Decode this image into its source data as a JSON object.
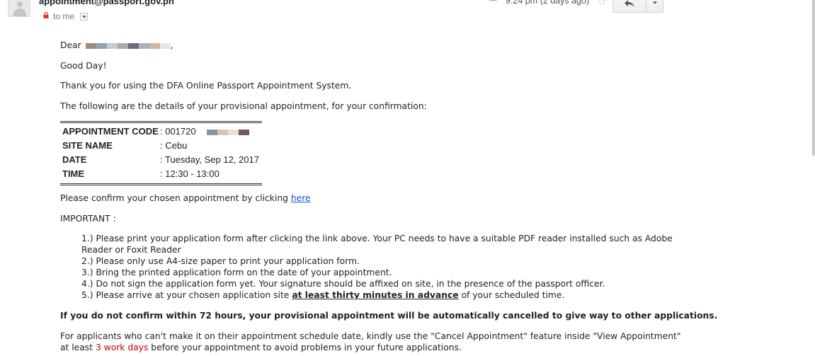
{
  "header": {
    "sender": "appointment@passport.gov.ph",
    "recipient_label": "to me",
    "time": "9:24 pm (2 days ago)"
  },
  "icons": [
    "avatar",
    "lock-icon",
    "chevron-down-icon",
    "paperclip-icon",
    "star-icon",
    "reply-icon",
    "more-options-icon"
  ],
  "redaction_colors": {
    "name": [
      "#9b8e7e",
      "#8fa3b0",
      "#c9c9cf",
      "#b1a6ad",
      "#6f6a78",
      "#a7b1c1",
      "#d4b49f",
      "#e2e6ec"
    ],
    "code": [
      "#8a92a6",
      "#d9c5b5",
      "#e8e0d8",
      "#6f5a55"
    ]
  },
  "email": {
    "greeting": "Dear",
    "greeting_punct": ",",
    "good_day": "Good Day!",
    "thank_you": "Thank you for using the DFA Online Passport Appointment System.",
    "intro": "The following are the details of your provisional appointment, for your confirmation:",
    "table": [
      {
        "label": "APPOINTMENT CODE",
        "value": ": 001720"
      },
      {
        "label": "SITE NAME",
        "value": ": Cebu"
      },
      {
        "label": "DATE",
        "value": ": Tuesday, Sep 12, 2017"
      },
      {
        "label": "TIME",
        "value": ": 12:30 - 13:00"
      }
    ],
    "confirm_prefix": "Please confirm your chosen appointment by clicking",
    "confirm_link": "here",
    "important_label": "IMPORTANT :",
    "items": {
      "item1_line1": "1.) Please print your application form after clicking the link above. Your PC needs to have a suitable PDF reader installed such as Adobe",
      "item1_line2": "Reader or Foxit Reader",
      "item2": "2.) Please only use A4-size paper to print your application form.",
      "item3": "3.) Bring the printed application form on the date of your appointment.",
      "item4": "4.) Do not sign the application form yet. Your signature should be affixed on site, in the presence of the passport officer.",
      "item5_prefix": "5.) Please arrive at your chosen application site",
      "item5_emphasis": "at least thirty minutes in advance",
      "item5_suffix": "of your scheduled time."
    },
    "warning": "If you do not confirm within 72 hours, your provisional appointment will be automatically cancelled to give way to other applications.",
    "cancel_line1": "For applicants who can't make it on their appointment schedule date, kindly use the \"Cancel Appointment\" feature inside \"View Appointment\"",
    "cancel_line2_prefix": "at least",
    "cancel_line2_emphasis": "3 work days",
    "cancel_line2_suffix": "before your appointment to avoid problems in your future applications."
  }
}
